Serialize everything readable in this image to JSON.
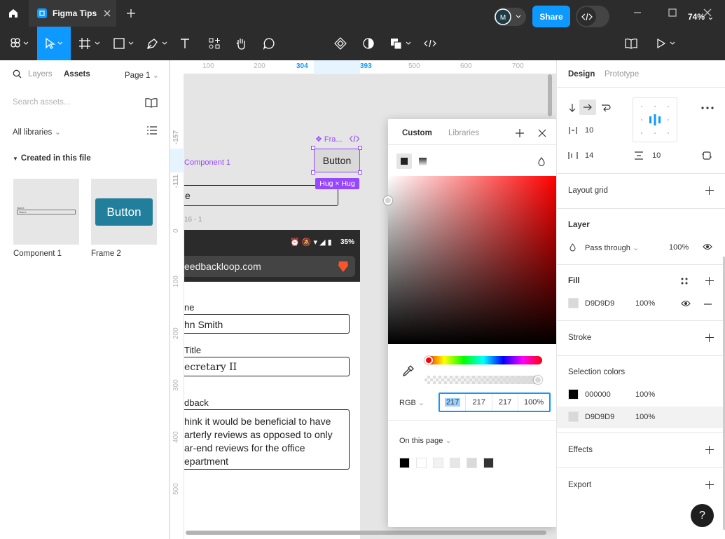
{
  "window": {
    "tab_title": "Figma Tips"
  },
  "toolbar": {
    "share_label": "Share",
    "zoom": "74%"
  },
  "left_panel": {
    "tabs": [
      "Layers",
      "Assets"
    ],
    "page": "Page 1",
    "search_placeholder": "Search assets...",
    "libraries_filter": "All libraries",
    "section_title": "Created in this file",
    "assets": [
      {
        "name": "Component 1",
        "preview_line1": "Name",
        "preview_line2": "Name"
      },
      {
        "name": "Frame 2",
        "preview_text": "Button"
      }
    ]
  },
  "rulers": {
    "top": [
      "100",
      "200",
      "304",
      "393",
      "500",
      "600",
      "700"
    ],
    "left": [
      "-157",
      "-111",
      "0",
      "100",
      "200",
      "300",
      "400",
      "500"
    ]
  },
  "canvas": {
    "component_label": "Component 1",
    "frame_label": "Fra...",
    "button_text": "Button",
    "hug_badge": "Hug × Hug",
    "field_partial": "e",
    "frame_label_2": "16 - 1",
    "status_battery": "35%",
    "url": "eedbackloop.com",
    "form": [
      {
        "label": "ne",
        "value": "hn Smith"
      },
      {
        "label": "Title",
        "value": "ecretary II"
      },
      {
        "label": "dback",
        "value_lines": [
          "hink it would be beneficial to have",
          "arterly reviews as opposed to only",
          "ar-end reviews for the office",
          "epartment"
        ]
      }
    ]
  },
  "color_picker": {
    "tabs": [
      "Custom",
      "Libraries"
    ],
    "mode": "RGB",
    "values": [
      "217",
      "217",
      "217",
      "100%"
    ],
    "on_this_page": "On this page",
    "swatches": [
      "#000000",
      "#ffffff",
      "#f2f2f2",
      "#e6e6e6",
      "#d9d9d9",
      "#333333"
    ]
  },
  "design_panel": {
    "tabs": [
      "Design",
      "Prototype"
    ],
    "autolayout": {
      "gap": "10",
      "padding_h": "14",
      "padding_v": "10"
    },
    "layout_grid": "Layout grid",
    "layer": {
      "title": "Layer",
      "blend": "Pass through",
      "opacity": "100%"
    },
    "fill": {
      "title": "Fill",
      "hex": "D9D9D9",
      "opacity": "100%",
      "color": "#d9d9d9"
    },
    "stroke": "Stroke",
    "selection_colors": {
      "title": "Selection colors",
      "items": [
        {
          "hex": "000000",
          "opacity": "100%",
          "color": "#000000"
        },
        {
          "hex": "D9D9D9",
          "opacity": "100%",
          "color": "#d9d9d9"
        }
      ]
    },
    "effects": "Effects",
    "export": "Export",
    "help": "?"
  },
  "colors": {
    "accent": "#0d99ff",
    "component_purple": "#9747ff",
    "chrome": "#2c2c2c"
  }
}
